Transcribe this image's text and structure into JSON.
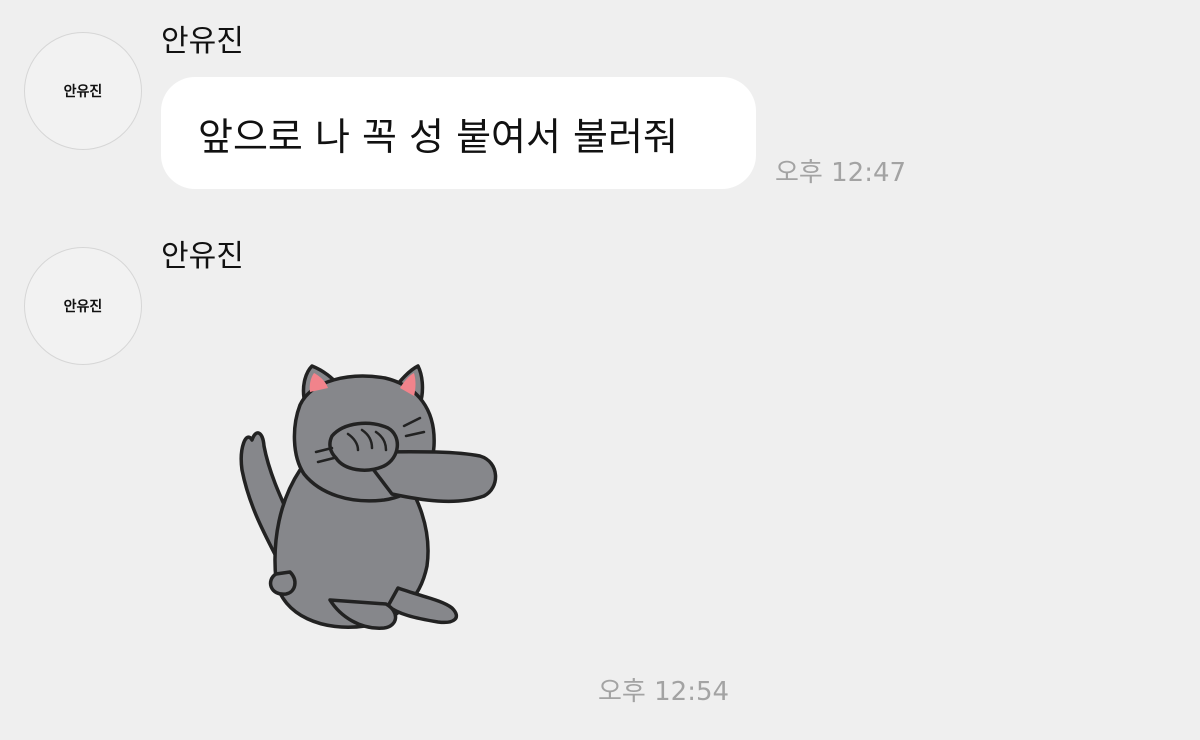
{
  "messages": [
    {
      "avatar_label": "안유진",
      "sender": "안유진",
      "text": "앞으로 나 꼭 성 붙여서 불러줘",
      "time": "오후 12:47"
    },
    {
      "avatar_label": "안유진",
      "sender": "안유진",
      "sticker": "cat-covering-face-sticker",
      "time": "오후 12:54"
    }
  ],
  "colors": {
    "background": "#efefef",
    "bubble": "#ffffff",
    "cat_body": "#86878b",
    "cat_ear_inner": "#f1838b"
  }
}
